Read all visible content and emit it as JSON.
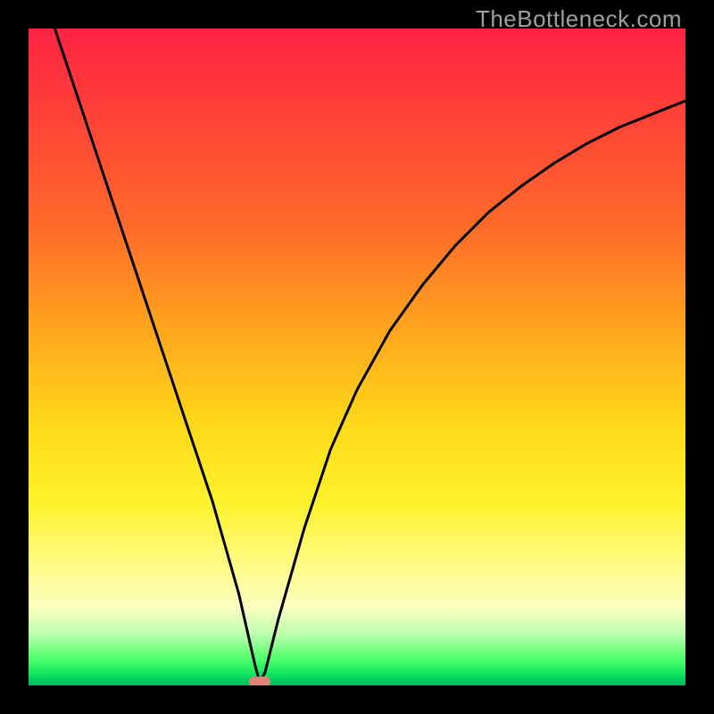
{
  "watermark": "TheBottleneck.com",
  "colors": {
    "frame": "#000000",
    "gradient_top": "#ff2345",
    "gradient_mid_orange": "#ffa21e",
    "gradient_mid_yellow": "#ffd81a",
    "gradient_bottom_green": "#00c060",
    "curve": "#000000",
    "marker": "#e18077"
  },
  "chart_data": {
    "type": "line",
    "title": "",
    "xlabel": "",
    "ylabel": "",
    "xlim": [
      0,
      100
    ],
    "ylim": [
      0,
      100
    ],
    "grid": false,
    "legend": false,
    "series": [
      {
        "name": "bottleneck-curve",
        "x": [
          4,
          8,
          12,
          16,
          20,
          24,
          28,
          32,
          34.5,
          35.2,
          36,
          38,
          42,
          46,
          50,
          55,
          60,
          65,
          70,
          75,
          80,
          85,
          90,
          95,
          100
        ],
        "y": [
          100,
          88,
          76,
          64,
          52,
          40,
          28,
          14,
          3,
          0.5,
          2,
          10,
          24,
          36,
          45,
          54,
          61,
          67,
          72,
          76,
          79.5,
          82.5,
          85,
          87,
          89
        ]
      }
    ],
    "annotations": [
      {
        "name": "optimal-marker",
        "x": 35.2,
        "y": 0.5
      }
    ]
  }
}
